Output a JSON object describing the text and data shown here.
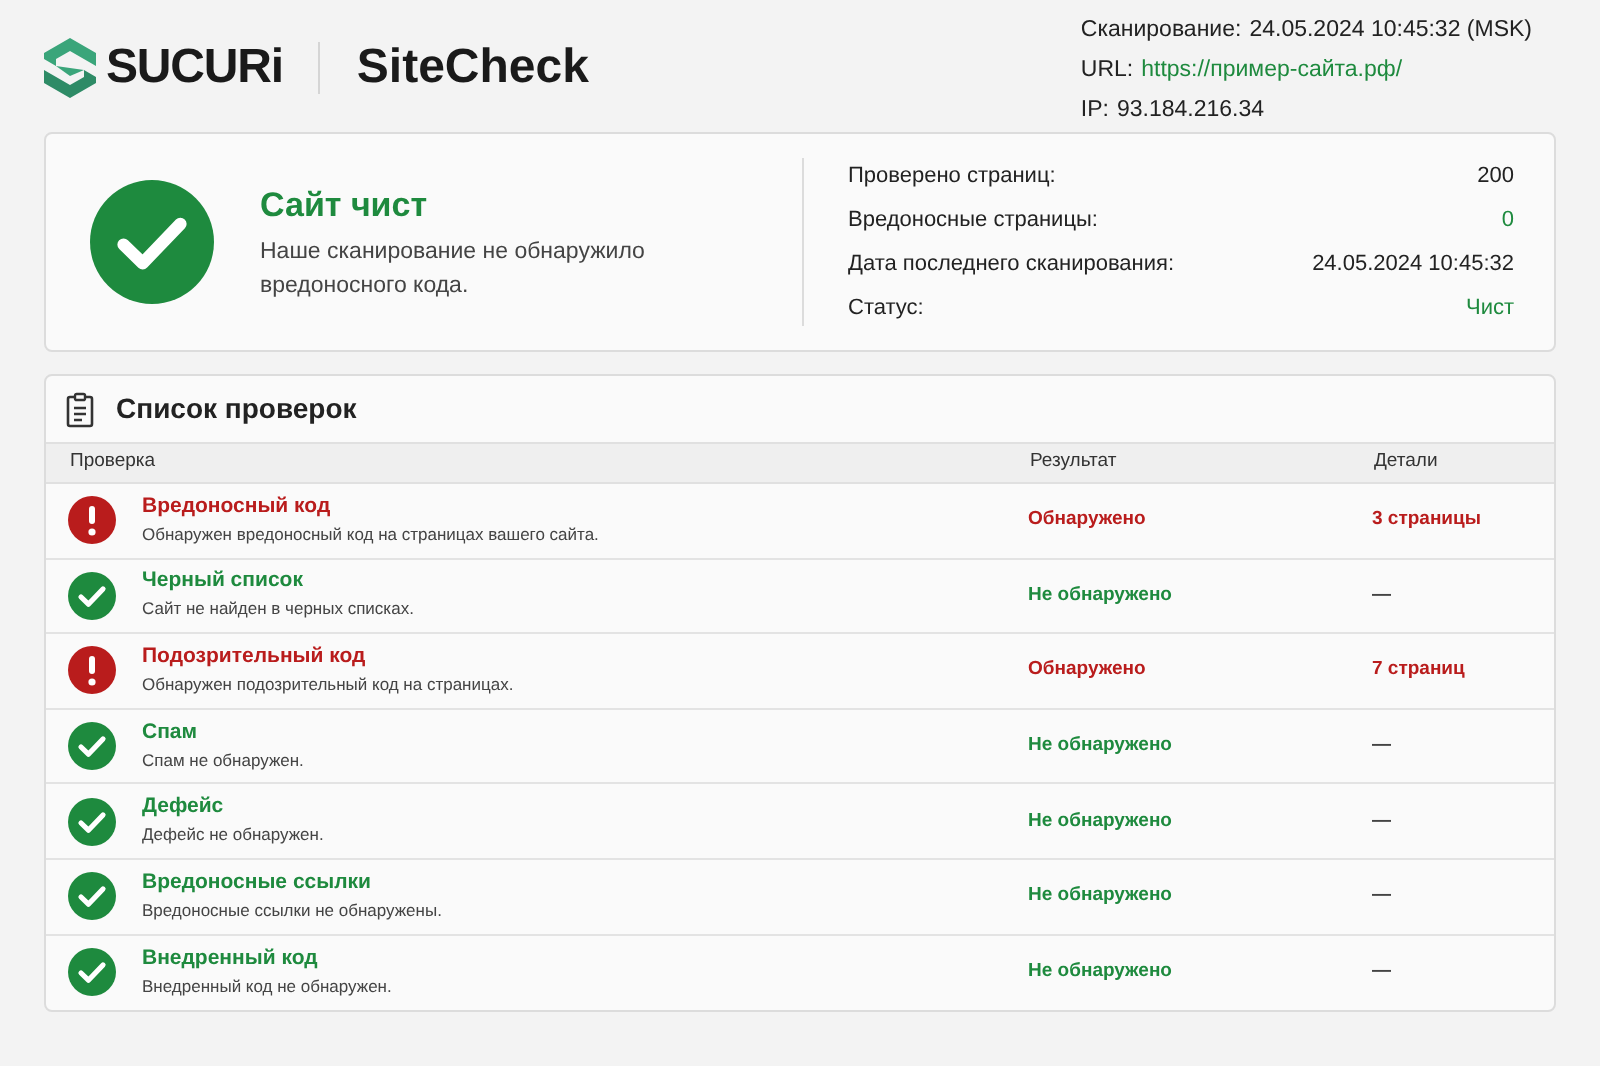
{
  "header": {
    "logo": "SUCURi",
    "product": "SiteCheck",
    "scan_info": [
      {
        "label": "Сканирование:",
        "value": "24.05.2024 10:45:32 (MSK)",
        "kind": "plain"
      },
      {
        "label": "URL:",
        "value": "https://пример-сайта.рф/",
        "kind": "link"
      },
      {
        "label": "IP:",
        "value": "93.184.216.34",
        "kind": "plain"
      }
    ]
  },
  "summary": {
    "title": "Сайт чист",
    "description": "Наше сканирование не обнаружило вредоносного кода.",
    "stats": [
      {
        "label": "Проверено страниц:",
        "value": "200",
        "kind": "plain"
      },
      {
        "label": "Вредоносные страницы:",
        "value": "0",
        "kind": "good"
      },
      {
        "label": "Дата последнего сканирования:",
        "value": "24.05.2024 10:45:32",
        "kind": "plain"
      },
      {
        "label": "Статус:",
        "value": "Чист",
        "kind": "good"
      }
    ]
  },
  "checks": {
    "title": "Список проверок",
    "columns": [
      "Проверка",
      "Результат",
      "Детали"
    ],
    "rows": [
      {
        "kind": "detected",
        "name": "Вредоносный код",
        "description": "Обнаружен вредоносный код на страницах вашего сайта.",
        "result": "Обнаружено",
        "details": "3 страницы"
      },
      {
        "kind": "clean",
        "name": "Черный список",
        "description": "Сайт не найден в черных списках.",
        "result": "Не обнаружено",
        "details": "—"
      },
      {
        "kind": "detected",
        "name": "Подозрительный код",
        "description": "Обнаружен подозрительный код на страницах.",
        "result": "Обнаружено",
        "details": "7 страниц"
      },
      {
        "kind": "clean",
        "name": "Спам",
        "description": "Спам не обнаружен.",
        "result": "Не обнаружено",
        "details": "—"
      },
      {
        "kind": "clean",
        "name": "Дефейс",
        "description": "Дефейс не обнаружен.",
        "result": "Не обнаружено",
        "details": "—"
      },
      {
        "kind": "clean",
        "name": "Вредоносные ссылки",
        "description": "Вредоносные ссылки не обнаружены.",
        "result": "Не обнаружено",
        "details": "—"
      },
      {
        "kind": "clean",
        "name": "Внедренный код",
        "description": "Внедренный код не обнаружен.",
        "result": "Не обнаружено",
        "details": "—"
      }
    ]
  }
}
